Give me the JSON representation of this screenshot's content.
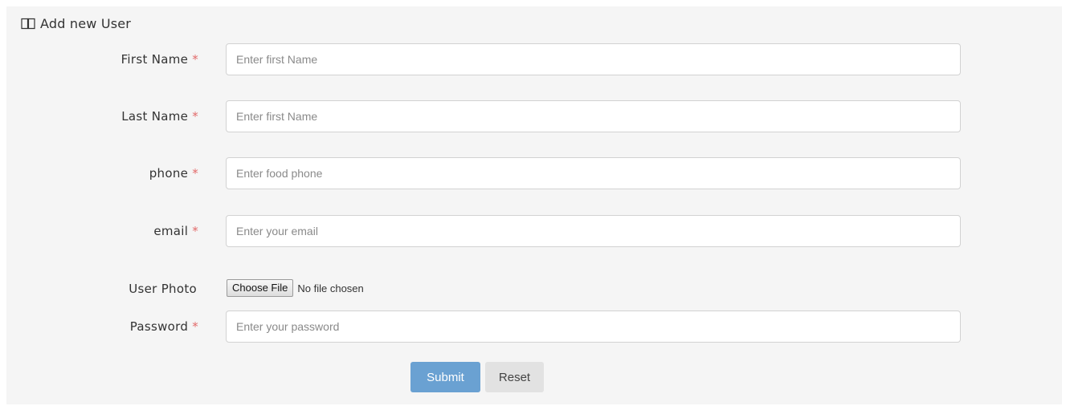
{
  "panel": {
    "title": "Add new User",
    "title_icon": "book-icon"
  },
  "form": {
    "required_marker": "*",
    "fields": {
      "first_name": {
        "label": "First Name",
        "placeholder": "Enter first Name",
        "value": "",
        "required": true
      },
      "last_name": {
        "label": "Last Name",
        "placeholder": "Enter first Name",
        "value": "",
        "required": true
      },
      "phone": {
        "label": "phone",
        "placeholder": "Enter food phone",
        "value": "",
        "required": true
      },
      "email": {
        "label": "email",
        "placeholder": "Enter your email",
        "value": "",
        "required": true
      },
      "user_photo": {
        "label": "User Photo",
        "button_label": "Choose File",
        "status": "No file chosen",
        "required": false
      },
      "password": {
        "label": "Password",
        "placeholder": "Enter your password",
        "value": "",
        "required": true
      }
    },
    "actions": {
      "submit_label": "Submit",
      "reset_label": "Reset"
    }
  },
  "colors": {
    "panel_background": "#f5f5f5",
    "required_marker": "#e26a6a",
    "submit_button": "#6aa1d2",
    "reset_button": "#e2e2e2"
  }
}
